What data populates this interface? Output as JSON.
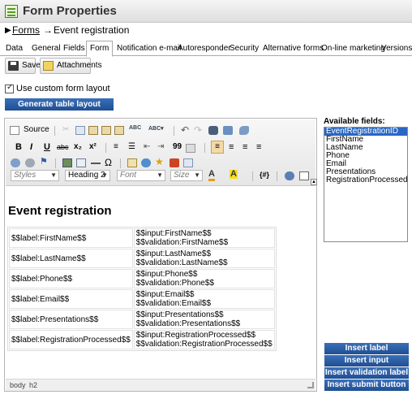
{
  "header": {
    "title": "Form Properties"
  },
  "breadcrumb": {
    "arrow": "▶",
    "forms_link": "Forms",
    "separator": "→",
    "current": "Event registration"
  },
  "tabs": [
    "Data",
    "General",
    "Fields",
    "Form",
    "Notification e-mail",
    "Autoresponder",
    "Security",
    "Alternative forms",
    "On-line marketing",
    "Versions"
  ],
  "active_tab": "Form",
  "toolbar": {
    "save_label": "Save",
    "attachments_label": "Attachments"
  },
  "custom_layout": {
    "checked": true,
    "label": "Use custom form layout"
  },
  "generate_button": "Generate table layout",
  "editor_toolbar": {
    "source_label": "Source",
    "styles": "Styles",
    "format": "Heading 2",
    "font": "Font",
    "size": "Size",
    "bold": "B",
    "italic": "I",
    "underline": "U",
    "strike": "abc",
    "subscript": "x₂",
    "superscript": "x²",
    "quote": "99",
    "omega": "Ω",
    "text_color": "A",
    "bg_color": "A",
    "macro": "{#}"
  },
  "editor": {
    "heading": "Event registration",
    "rows": [
      {
        "label": "$$label:FirstName$$",
        "input": "$$input:FirstName$$",
        "validation": "$$validation:FirstName$$"
      },
      {
        "label": "$$label:LastName$$",
        "input": "$$input:LastName$$",
        "validation": "$$validation:LastName$$"
      },
      {
        "label": "$$label:Phone$$",
        "input": "$$input:Phone$$",
        "validation": "$$validation:Phone$$"
      },
      {
        "label": "$$label:Email$$",
        "input": "$$input:Email$$",
        "validation": "$$validation:Email$$"
      },
      {
        "label": "$$label:Presentations$$",
        "input": "$$input:Presentations$$",
        "validation": "$$validation:Presentations$$"
      },
      {
        "label": "$$label:RegistrationProcessed$$",
        "input": "$$input:RegistrationProcessed$$",
        "validation": "$$validation:RegistrationProcessed$$"
      }
    ],
    "status": {
      "path1": "body",
      "path2": "h2"
    }
  },
  "available_fields": {
    "label": "Available fields:",
    "items": [
      "EventRegistrationID",
      "FirstName",
      "LastName",
      "Phone",
      "Email",
      "Presentations",
      "RegistrationProcessed"
    ],
    "selected": "EventRegistrationID"
  },
  "insert_buttons": [
    "Insert label",
    "Insert input",
    "Insert validation label",
    "Insert submit button"
  ],
  "colors": {
    "accent": "#2a5ca8",
    "selected": "#2867c4"
  }
}
